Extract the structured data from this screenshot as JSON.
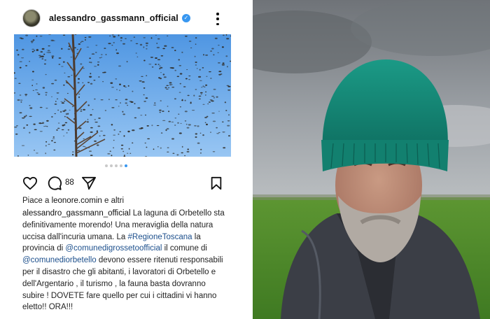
{
  "post": {
    "username": "alessandro_gassmann_official",
    "verified_mark": "✓",
    "comment_count": "88",
    "likes_prefix": "Piace a ",
    "likes_user": "leonore.comin",
    "likes_suffix": " e altri",
    "caption": {
      "user": "alessandro_gassmann_official",
      "part1": " La laguna di Orbetello sta definitivamente morendo! Una meraviglia della natura uccisa dall'incuria umana. La ",
      "hashtag": "#RegioneToscana",
      "part2": " la provincia di ",
      "mention1": "@comunedigrossetoofficial",
      "part3": " il comune di ",
      "mention2": "@comunediorbetello",
      "part4": " devono essere ritenuti responsabili per il disastro che gli abitanti, i lavoratori di Orbetello e dell'Argentario , il turismo , la fauna basta dovranno subire ! DOVETE fare quello per cui i cittadini vi hanno eletto!! ORA!!!"
    },
    "carousel": {
      "count": 5,
      "active_index": 4
    },
    "icons": [
      "more-icon",
      "heart-icon",
      "comment-icon",
      "share-icon",
      "bookmark-icon",
      "verified-icon"
    ]
  },
  "colors": {
    "verified": "#3897f0",
    "link": "#1c4f8c",
    "sky": "#6aaaf0",
    "beanie": "#14806f",
    "grass": "#4f8a2a"
  }
}
